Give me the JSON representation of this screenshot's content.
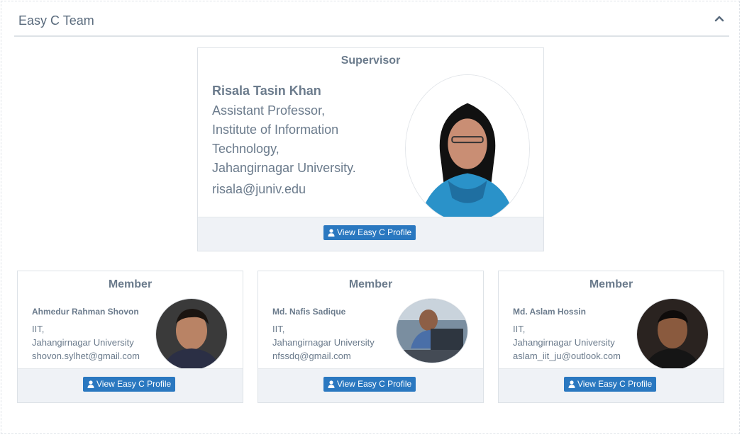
{
  "panel": {
    "title": "Easy C Team",
    "collapse_icon": "chevron-up-icon"
  },
  "supervisor": {
    "heading": "Supervisor",
    "name": "Risala Tasin Khan",
    "title_lines": [
      "Assistant Professor,",
      "Institute of Information",
      "Technology,",
      "Jahangirnagar University."
    ],
    "email": "risala@juniv.edu",
    "button_label": "View Easy C Profile",
    "button_icon": "user-icon"
  },
  "members": [
    {
      "heading": "Member",
      "name": "Ahmedur Rahman Shovon",
      "lines": [
        "IIT,",
        "Jahangirnagar University",
        "shovon.sylhet@gmail.com"
      ],
      "button_label": "View Easy C Profile"
    },
    {
      "heading": "Member",
      "name": "Md. Nafis Sadique",
      "lines": [
        "IIT,",
        "Jahangirnagar University",
        "nfssdq@gmail.com"
      ],
      "button_label": "View Easy C Profile"
    },
    {
      "heading": "Member",
      "name": "Md. Aslam Hossin",
      "lines": [
        "IIT,",
        "Jahangirnagar University",
        "aslam_iit_ju@outlook.com"
      ],
      "button_label": "View Easy C Profile"
    }
  ],
  "colors": {
    "button": "#2a78c0",
    "footer": "#eff2f6",
    "text": "#6b7b8c"
  }
}
